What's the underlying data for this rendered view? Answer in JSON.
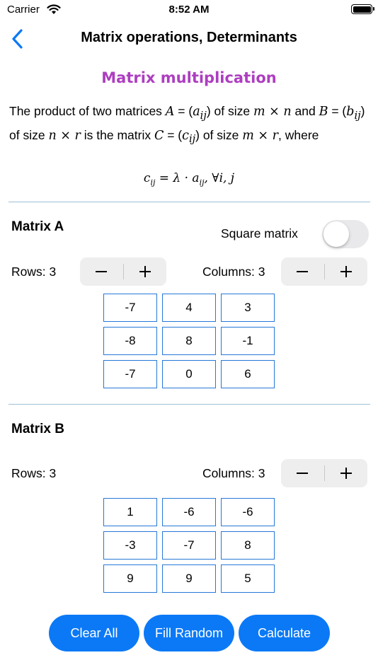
{
  "status_bar": {
    "carrier": "Carrier",
    "time": "8:52 AM"
  },
  "nav": {
    "title": "Matrix operations, Determinants"
  },
  "section": {
    "title": "Matrix multiplication",
    "desc_1": "The product of two matrices ",
    "sym_A": "A",
    "desc_2": " = (",
    "sym_a": "a",
    "sub_ij_1": "ij",
    "desc_3": ") of size ",
    "sym_mn": "m × n",
    "desc_4": " and ",
    "sym_B": "B",
    "desc_5": " = (",
    "sym_b": "b",
    "sub_ij_2": "ij",
    "desc_6": ") of size ",
    "sym_nr": "n × r",
    "desc_7": " is the matrix ",
    "sym_C": "C",
    "desc_8": " = (",
    "sym_c": "c",
    "sub_ij_3": "ij",
    "desc_9": ") of size ",
    "sym_mr": "m × r",
    "desc_10": ", where",
    "formula_c": "c",
    "formula_sub1": "ij",
    "formula_mid": " = λ · a",
    "formula_sub2": "ij",
    "formula_end": ", ∀i, j"
  },
  "matrix_a": {
    "label": "Matrix A",
    "square_label": "Square matrix",
    "square_on": false,
    "rows_label": "Rows: 3",
    "cols_label": "Columns: 3",
    "cells": [
      "-7",
      "4",
      "3",
      "-8",
      "8",
      "-1",
      "-7",
      "0",
      "6"
    ]
  },
  "matrix_b": {
    "label": "Matrix B",
    "rows_label": "Rows: 3",
    "cols_label": "Columns: 3",
    "cells": [
      "1",
      "-6",
      "-6",
      "-3",
      "-7",
      "8",
      "9",
      "9",
      "5"
    ]
  },
  "stepper": {
    "minus": "−",
    "plus": "+"
  },
  "actions": {
    "clear": "Clear All",
    "random": "Fill Random",
    "calculate": "Calculate"
  },
  "colors": {
    "accent": "#0b79f6",
    "title": "#ad3ec0",
    "cell_border": "#2678d8"
  }
}
